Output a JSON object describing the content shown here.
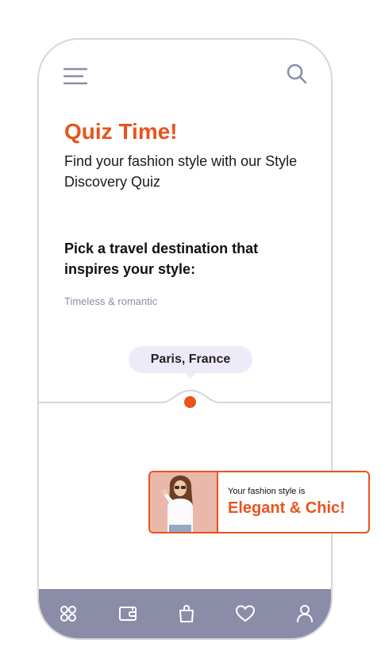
{
  "colors": {
    "accent": "#e8541c",
    "nav_bg": "#8b8ca8",
    "tooltip_bg": "#efeaf9",
    "muted_text": "#8b8ca4"
  },
  "header": {
    "menu_icon": "hamburger-menu-icon",
    "search_icon": "search-icon"
  },
  "quiz": {
    "title": "Quiz Time!",
    "subtitle": "Find your fashion style with our Style Discovery Quiz",
    "question": "Pick a travel destination that inspires your style:",
    "hint": "Timeless & romantic",
    "selected_option": "Paris, France"
  },
  "result": {
    "caption": "Your fashion style is",
    "style": "Elegant & Chic!"
  },
  "bottom_nav": {
    "items": [
      {
        "icon": "grid-icon"
      },
      {
        "icon": "wallet-icon"
      },
      {
        "icon": "shopping-bag-icon"
      },
      {
        "icon": "heart-icon"
      },
      {
        "icon": "user-icon"
      }
    ]
  }
}
